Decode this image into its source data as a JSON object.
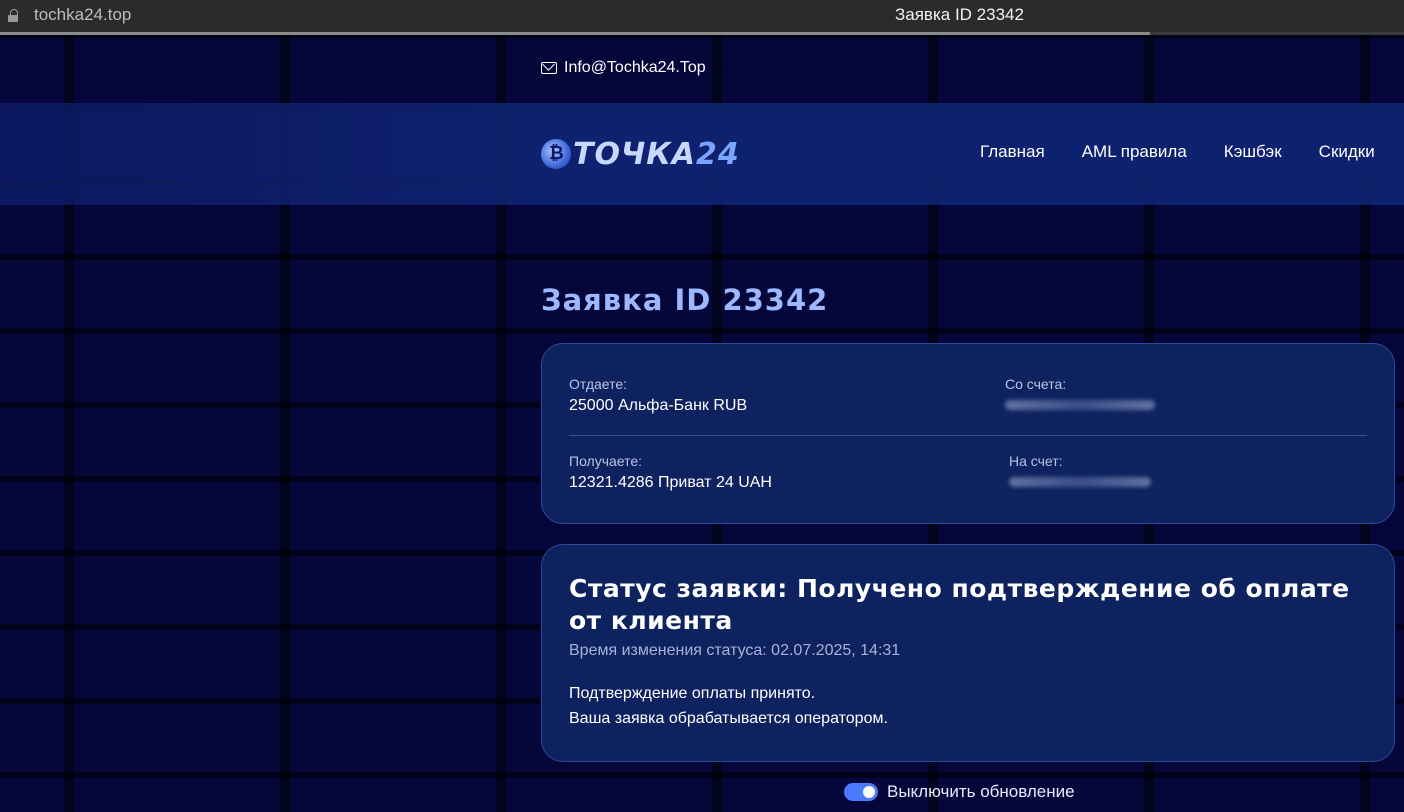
{
  "browser": {
    "url": "tochka24.top",
    "tab_title": "Заявка ID 23342"
  },
  "header": {
    "email": "Info@Tochka24.Top",
    "logo_text": "ТОЧКА",
    "logo_number": "24",
    "nav": [
      {
        "label": "Главная"
      },
      {
        "label": "AML правила"
      },
      {
        "label": "Кэшбэк"
      },
      {
        "label": "Скидки"
      }
    ]
  },
  "order": {
    "title": "Заявка ID 23342",
    "give_label": "Отдаете:",
    "give_value": "25000 Альфа-Банк RUB",
    "from_account_label": "Со счета:",
    "receive_label": "Получаете:",
    "receive_value": "12321.4286 Приват 24 UAH",
    "to_account_label": "На счет:"
  },
  "status": {
    "title": "Статус заявки: Получено подтверждение об оплате от клиента",
    "time": "Время изменения статуса: 02.07.2025, 14:31",
    "message_line1": "Подтверждение оплаты принято.",
    "message_line2": "Ваша заявка обрабатывается оператором."
  },
  "toggle": {
    "label": "Выключить обновление",
    "on": true
  },
  "colors": {
    "background": "#05073a",
    "card": "#0e2260",
    "accent": "#4a7bff",
    "title": "#9db8ff"
  }
}
